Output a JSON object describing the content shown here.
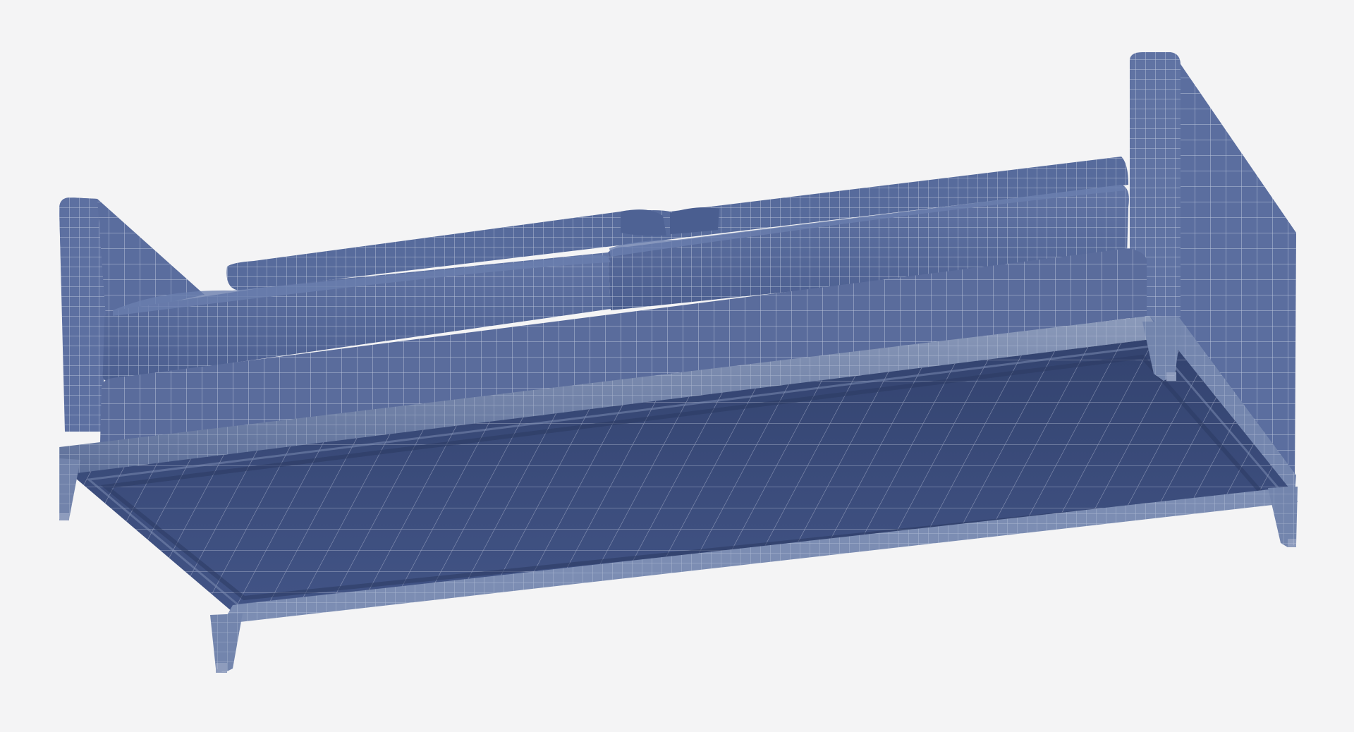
{
  "scene": {
    "subject": "sofa-wireframe-render",
    "view": "underside-perspective",
    "colors": {
      "background": "#f4f4f5",
      "fabric": "#55699a",
      "fabric_dark": "#3d5080",
      "fabric_light": "#6a7eaf",
      "underside": "#3d4e7e",
      "underside_dark": "#2f3f6b",
      "frame": "#6e81a9",
      "frame_light": "#9aa7c4",
      "wire": "#d8deea"
    }
  }
}
